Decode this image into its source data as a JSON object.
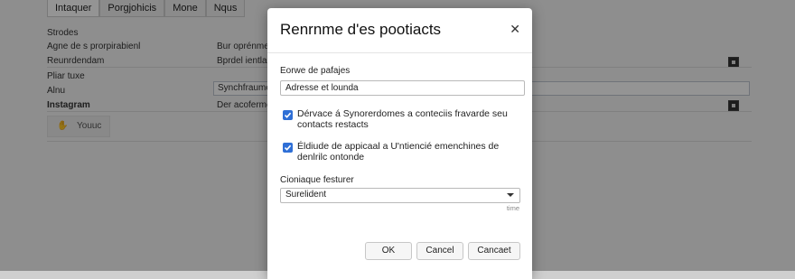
{
  "background": {
    "tabs": [
      "Intaquer",
      "Porgjohicis",
      "Mone",
      "Nqus"
    ],
    "rows": [
      {
        "section": "Strodes"
      },
      {
        "left": "Agne de s prorpirabienl",
        "mid": "Bur oprénme"
      },
      {
        "left": "Reunrdendam",
        "mid": "Bprdel ientla"
      },
      {
        "section": "Pliar tuxe"
      },
      {
        "left": "Alnu",
        "field": "Synchfraume"
      },
      {
        "left": "Instagram",
        "mid": "Der acoferme"
      }
    ],
    "card": {
      "label": "Youuc",
      "icon": "hand-icon"
    }
  },
  "dialog": {
    "title": "Renrnme d'es pootiacts",
    "close_icon": "close-icon",
    "field_label": "Eorwe de pafajes",
    "field_value": "Adresse et lounda",
    "checkbox1": "Dérvace á Synorerdomes a conteciis fravarde seu contacts restacts",
    "checkbox2": "Éldiude de appicaal a U'ntiencié emenchines de denlrilc ontonde",
    "select_label": "Cioniaque festurer",
    "select_value": "Surelident",
    "hint": "time",
    "buttons": {
      "ok": "OK",
      "cancel": "Cancel",
      "cancel2": "Cancaet"
    }
  },
  "colors": {
    "accent": "#2f6fd6",
    "overlay": "rgba(0,0,0,0.42)"
  }
}
